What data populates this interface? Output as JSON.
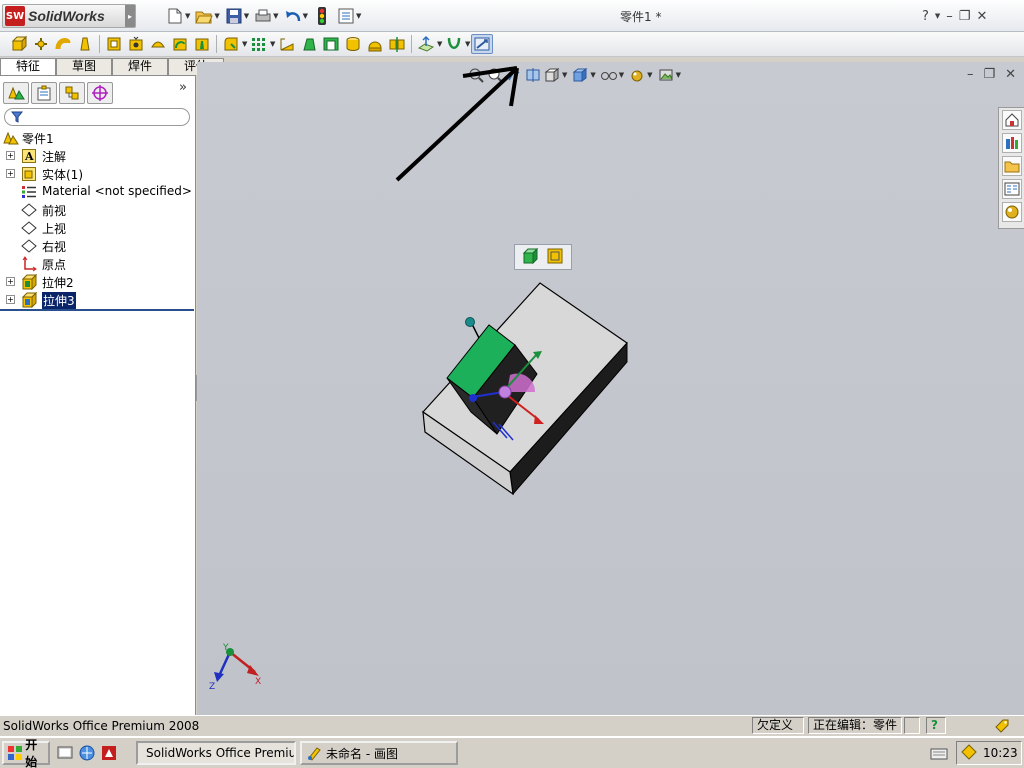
{
  "app": {
    "logo_mark": "SW",
    "logo_text": "SolidWorks",
    "title": "零件1 *",
    "help": "?"
  },
  "feature_tabs": [
    {
      "label": "特征",
      "active": true
    },
    {
      "label": "草图",
      "active": false
    },
    {
      "label": "焊件",
      "active": false
    },
    {
      "label": "评估",
      "active": false
    }
  ],
  "manager": {
    "more": "»"
  },
  "tree": {
    "root": "零件1",
    "items": [
      {
        "label": "注解",
        "expandable": true
      },
      {
        "label": "实体(1)",
        "expandable": true
      },
      {
        "label": "Material <not specified>",
        "expandable": false
      },
      {
        "label": "前视",
        "expandable": false
      },
      {
        "label": "上视",
        "expandable": false
      },
      {
        "label": "右视",
        "expandable": false
      },
      {
        "label": "原点",
        "expandable": false
      },
      {
        "label": "拉伸2",
        "expandable": true
      },
      {
        "label": "拉伸3",
        "expandable": true,
        "selected": true
      }
    ]
  },
  "triad": {
    "x": "X",
    "y": "Y",
    "z": "Z"
  },
  "status": {
    "product": "SolidWorks Office Premium 2008",
    "definition": "欠定义",
    "editing": "正在编辑：零件",
    "help": "?"
  },
  "taskbar": {
    "start": "开始",
    "tasks": [
      {
        "label": "SolidWorks Office Premiu...",
        "active": true
      },
      {
        "label": "未命名 - 画图",
        "active": false
      }
    ],
    "clock": "10:23"
  },
  "colors": {
    "accent_selection": "#0a246a",
    "viewport_bg": "#c3c6cd",
    "model_green": "#1db05a",
    "model_top": "#d8d8d8",
    "model_side": "#1c1c1c",
    "brand_red": "#c41e1e"
  }
}
